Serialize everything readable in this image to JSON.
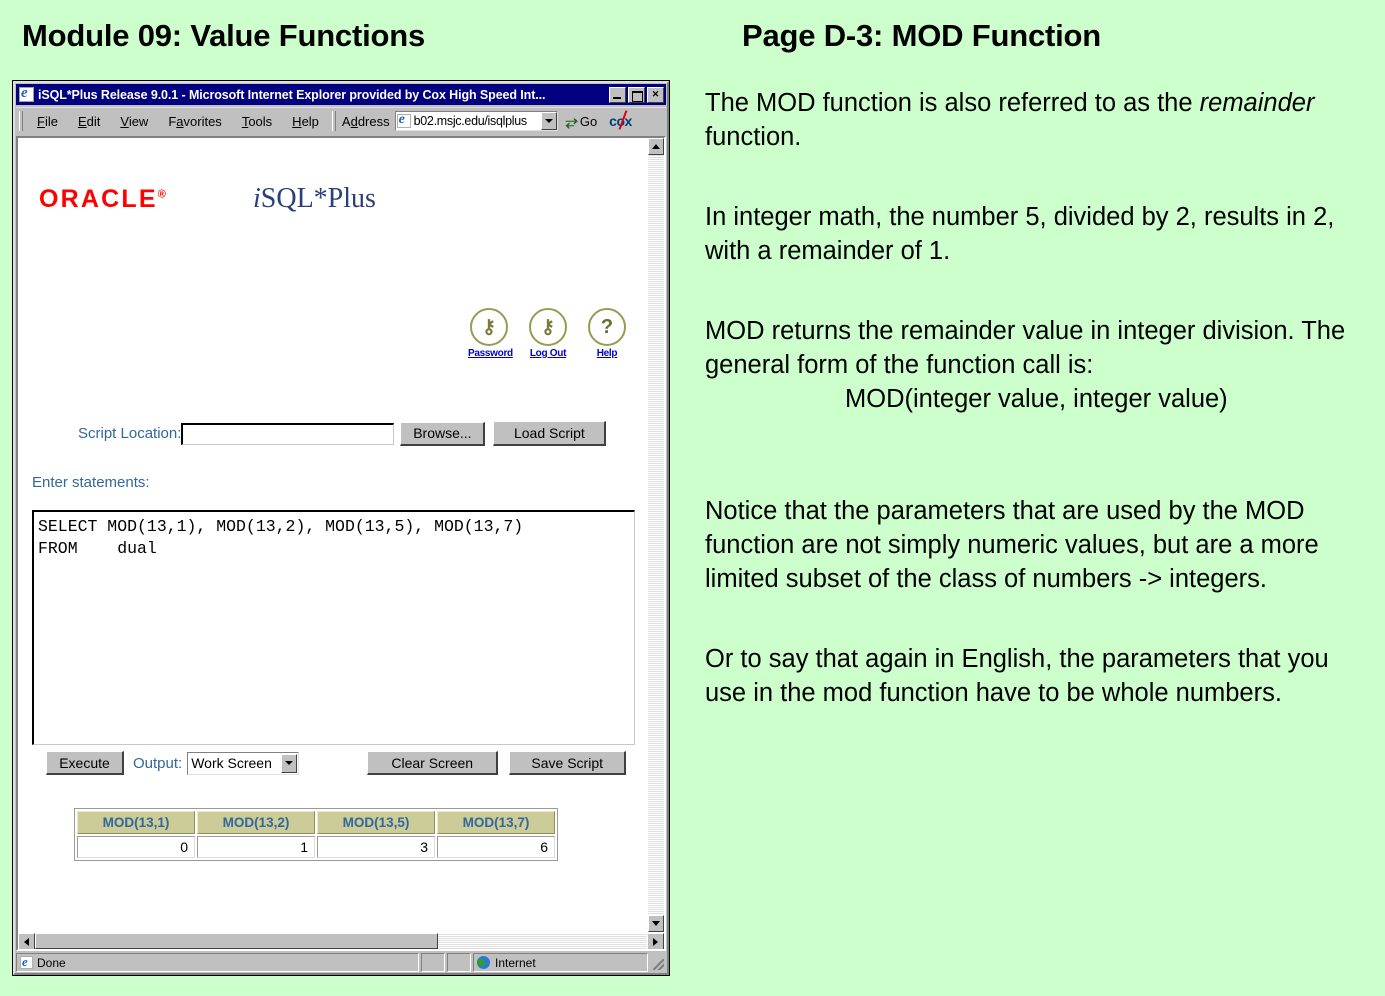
{
  "slide": {
    "background_color": "#ccffcc",
    "heading_left": "Module 09: Value Functions",
    "heading_right": "Page D-3:  MOD Function"
  },
  "notes": {
    "p1_a": "The MOD function is also referred to as the ",
    "p1_italic": "remainder",
    "p1_b": " function.",
    "p2": "In integer math, the number 5, divided by 2, results in 2, with a remainder of 1.",
    "p3": "MOD returns the remainder value in integer division.  The general form of the function call is:",
    "p3_syntax": "MOD(integer value, integer value)",
    "p4": "Notice that the parameters that are used by the MOD function are not simply numeric values, but are a more limited subset of the class of numbers -> integers.",
    "p5": "Or to say that again in English, the parameters that you use in the mod function have to be whole numbers."
  },
  "browser": {
    "title": "iSQL*Plus Release 9.0.1 - Microsoft Internet Explorer provided by Cox High Speed Int...",
    "window_buttons": {
      "minimize": "",
      "maximize": "",
      "close": "✕"
    },
    "menu": [
      "File",
      "Edit",
      "View",
      "Favorites",
      "Tools",
      "Help"
    ],
    "menu_mnemonics": [
      "F",
      "E",
      "V",
      "a",
      "T",
      "H"
    ],
    "address_label": "Address",
    "address_value": "b02.msjc.edu/isqlplus",
    "go_label": "Go",
    "isp_brand": "cox",
    "status": {
      "done": "Done",
      "zone": "Internet"
    }
  },
  "isqlplus": {
    "oracle_logo": "ORACLE",
    "product_i": "i",
    "product_rest": "SQL*Plus",
    "tools": [
      {
        "name": "Password",
        "glyph": "⚷"
      },
      {
        "name": "Log Out",
        "glyph": "⚷"
      },
      {
        "name": "Help",
        "glyph": "?"
      }
    ],
    "script_location_label": "Script Location:",
    "script_location_value": "",
    "script_location_placeholder": "",
    "browse_button": "Browse...",
    "load_script_button": "Load Script",
    "enter_statements_label": "Enter statements:",
    "sql_text": "SELECT MOD(13,1), MOD(13,2), MOD(13,5), MOD(13,7)\nFROM    dual",
    "execute_button": "Execute",
    "output_label": "Output:",
    "output_selected": "Work Screen",
    "output_options": [
      "Work Screen"
    ],
    "clear_screen_button": "Clear Screen",
    "save_script_button": "Save Script",
    "results": {
      "columns": [
        "MOD(13,1)",
        "MOD(13,2)",
        "MOD(13,5)",
        "MOD(13,7)"
      ],
      "rows": [
        [
          "0",
          "1",
          "3",
          "6"
        ]
      ],
      "header_bg": "#cccc99",
      "header_fg": "#33679c"
    }
  }
}
